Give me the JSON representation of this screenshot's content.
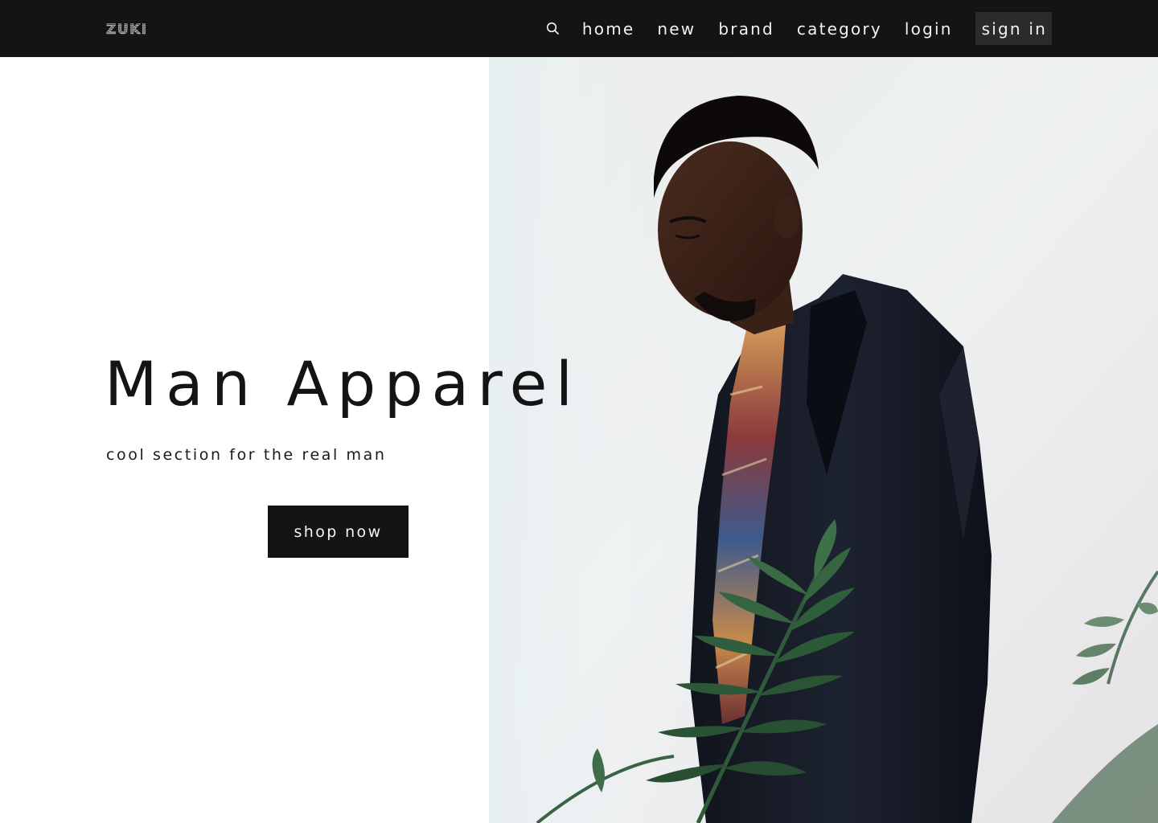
{
  "navbar": {
    "logo_text": "ZUKI",
    "search_icon": "search-icon",
    "links": [
      {
        "label": "home"
      },
      {
        "label": "new"
      },
      {
        "label": "brand"
      },
      {
        "label": "category"
      },
      {
        "label": "login"
      }
    ],
    "signin_label": "sign in"
  },
  "hero": {
    "title": "Man Apparel",
    "subtitle": "cool section for the real man",
    "cta_label": "shop now",
    "image_subject": "man in dark blazer with patterned scarf beside palm leaves"
  },
  "colors": {
    "navbar_bg": "#141414",
    "nav_text": "#f2f2f2",
    "signin_bg": "#2b2b2b",
    "button_bg": "#141414",
    "button_text": "#f5f5f5",
    "title_text": "#141414",
    "page_bg": "#ffffff"
  }
}
